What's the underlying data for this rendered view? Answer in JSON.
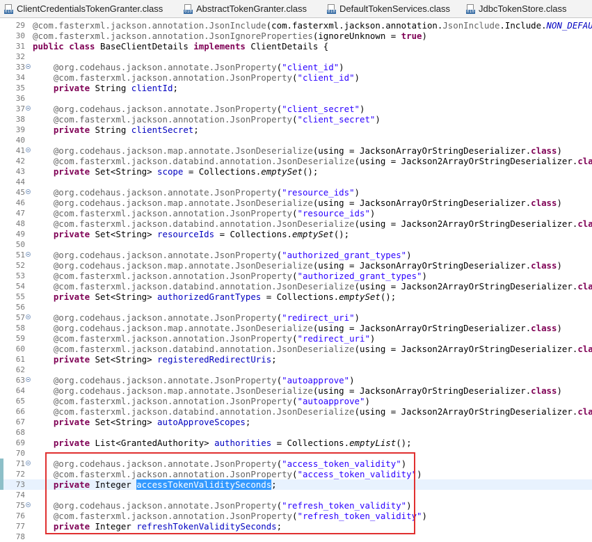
{
  "tabs": [
    {
      "label": "ClientCredentialsTokenGranter.class",
      "icon": "class-file-icon"
    },
    {
      "label": "AbstractTokenGranter.class",
      "icon": "class-file-icon"
    },
    {
      "label": "DefaultTokenServices.class",
      "icon": "class-file-icon"
    },
    {
      "label": "JdbcTokenStore.class",
      "icon": "class-file-icon"
    }
  ],
  "icon_badge": "010",
  "lines": [
    {
      "n": "29",
      "t": [
        [
          "ann",
          "@com.fasterxml.jackson.annotation."
        ],
        [
          "ann",
          "JsonInclude"
        ],
        [
          "",
          "(com.fasterxml.jackson.annotation."
        ],
        [
          "ann",
          "JsonInclude"
        ],
        [
          "",
          ".Include."
        ],
        [
          "fld it",
          "NON_DEFAULT"
        ],
        [
          "",
          ")"
        ]
      ]
    },
    {
      "n": "30",
      "t": [
        [
          "ann",
          "@com.fasterxml.jackson.annotation."
        ],
        [
          "ann",
          "JsonIgnoreProperties"
        ],
        [
          "",
          "(ignoreUnknown = "
        ],
        [
          "kw",
          "true"
        ],
        [
          "",
          ")"
        ]
      ]
    },
    {
      "n": "31",
      "t": [
        [
          "kw",
          "public class"
        ],
        [
          "",
          " BaseClientDetails "
        ],
        [
          "kw",
          "implements"
        ],
        [
          "",
          " ClientDetails {"
        ]
      ]
    },
    {
      "n": "32",
      "t": []
    },
    {
      "n": "33",
      "fold": true,
      "t": [
        [
          "",
          "    "
        ],
        [
          "ann",
          "@org.codehaus.jackson.annotate."
        ],
        [
          "ann",
          "JsonProperty"
        ],
        [
          "",
          "("
        ],
        [
          "str",
          "\"client_id\""
        ],
        [
          "",
          ")"
        ]
      ]
    },
    {
      "n": "34",
      "t": [
        [
          "",
          "    "
        ],
        [
          "ann",
          "@com.fasterxml.jackson.annotation."
        ],
        [
          "ann",
          "JsonProperty"
        ],
        [
          "",
          "("
        ],
        [
          "str",
          "\"client_id\""
        ],
        [
          "",
          ")"
        ]
      ]
    },
    {
      "n": "35",
      "t": [
        [
          "",
          "    "
        ],
        [
          "kw",
          "private"
        ],
        [
          "",
          " String "
        ],
        [
          "fld",
          "clientId"
        ],
        [
          "",
          ";"
        ]
      ]
    },
    {
      "n": "36",
      "t": []
    },
    {
      "n": "37",
      "fold": true,
      "t": [
        [
          "",
          "    "
        ],
        [
          "ann",
          "@org.codehaus.jackson.annotate."
        ],
        [
          "ann",
          "JsonProperty"
        ],
        [
          "",
          "("
        ],
        [
          "str",
          "\"client_secret\""
        ],
        [
          "",
          ")"
        ]
      ]
    },
    {
      "n": "38",
      "t": [
        [
          "",
          "    "
        ],
        [
          "ann",
          "@com.fasterxml.jackson.annotation."
        ],
        [
          "ann",
          "JsonProperty"
        ],
        [
          "",
          "("
        ],
        [
          "str",
          "\"client_secret\""
        ],
        [
          "",
          ")"
        ]
      ]
    },
    {
      "n": "39",
      "t": [
        [
          "",
          "    "
        ],
        [
          "kw",
          "private"
        ],
        [
          "",
          " String "
        ],
        [
          "fld",
          "clientSecret"
        ],
        [
          "",
          ";"
        ]
      ]
    },
    {
      "n": "40",
      "t": []
    },
    {
      "n": "41",
      "fold": true,
      "t": [
        [
          "",
          "    "
        ],
        [
          "ann",
          "@org.codehaus.jackson.map.annotate."
        ],
        [
          "ann",
          "JsonDeserialize"
        ],
        [
          "",
          "(using = JacksonArrayOrStringDeserializer."
        ],
        [
          "kw",
          "class"
        ],
        [
          "",
          ")"
        ]
      ]
    },
    {
      "n": "42",
      "t": [
        [
          "",
          "    "
        ],
        [
          "ann",
          "@com.fasterxml.jackson.databind.annotation."
        ],
        [
          "ann",
          "JsonDeserialize"
        ],
        [
          "",
          "(using = Jackson2ArrayOrStringDeserializer."
        ],
        [
          "kw",
          "class"
        ],
        [
          "",
          ")"
        ]
      ]
    },
    {
      "n": "43",
      "t": [
        [
          "",
          "    "
        ],
        [
          "kw",
          "private"
        ],
        [
          "",
          " Set<String> "
        ],
        [
          "fld",
          "scope"
        ],
        [
          "",
          " = Collections."
        ],
        [
          "it",
          "emptySet"
        ],
        [
          "",
          "();"
        ]
      ]
    },
    {
      "n": "44",
      "t": []
    },
    {
      "n": "45",
      "fold": true,
      "t": [
        [
          "",
          "    "
        ],
        [
          "ann",
          "@org.codehaus.jackson.annotate."
        ],
        [
          "ann",
          "JsonProperty"
        ],
        [
          "",
          "("
        ],
        [
          "str",
          "\"resource_ids\""
        ],
        [
          "",
          ")"
        ]
      ]
    },
    {
      "n": "46",
      "t": [
        [
          "",
          "    "
        ],
        [
          "ann",
          "@org.codehaus.jackson.map.annotate."
        ],
        [
          "ann",
          "JsonDeserialize"
        ],
        [
          "",
          "(using = JacksonArrayOrStringDeserializer."
        ],
        [
          "kw",
          "class"
        ],
        [
          "",
          ")"
        ]
      ]
    },
    {
      "n": "47",
      "t": [
        [
          "",
          "    "
        ],
        [
          "ann",
          "@com.fasterxml.jackson.annotation."
        ],
        [
          "ann",
          "JsonProperty"
        ],
        [
          "",
          "("
        ],
        [
          "str",
          "\"resource_ids\""
        ],
        [
          "",
          ")"
        ]
      ]
    },
    {
      "n": "48",
      "t": [
        [
          "",
          "    "
        ],
        [
          "ann",
          "@com.fasterxml.jackson.databind.annotation."
        ],
        [
          "ann",
          "JsonDeserialize"
        ],
        [
          "",
          "(using = Jackson2ArrayOrStringDeserializer."
        ],
        [
          "kw",
          "class"
        ],
        [
          "",
          ")"
        ]
      ]
    },
    {
      "n": "49",
      "t": [
        [
          "",
          "    "
        ],
        [
          "kw",
          "private"
        ],
        [
          "",
          " Set<String> "
        ],
        [
          "fld",
          "resourceIds"
        ],
        [
          "",
          " = Collections."
        ],
        [
          "it",
          "emptySet"
        ],
        [
          "",
          "();"
        ]
      ]
    },
    {
      "n": "50",
      "t": []
    },
    {
      "n": "51",
      "fold": true,
      "t": [
        [
          "",
          "    "
        ],
        [
          "ann",
          "@org.codehaus.jackson.annotate."
        ],
        [
          "ann",
          "JsonProperty"
        ],
        [
          "",
          "("
        ],
        [
          "str",
          "\"authorized_grant_types\""
        ],
        [
          "",
          ")"
        ]
      ]
    },
    {
      "n": "52",
      "t": [
        [
          "",
          "    "
        ],
        [
          "ann",
          "@org.codehaus.jackson.map.annotate."
        ],
        [
          "ann",
          "JsonDeserialize"
        ],
        [
          "",
          "(using = JacksonArrayOrStringDeserializer."
        ],
        [
          "kw",
          "class"
        ],
        [
          "",
          ")"
        ]
      ]
    },
    {
      "n": "53",
      "t": [
        [
          "",
          "    "
        ],
        [
          "ann",
          "@com.fasterxml.jackson.annotation."
        ],
        [
          "ann",
          "JsonProperty"
        ],
        [
          "",
          "("
        ],
        [
          "str",
          "\"authorized_grant_types\""
        ],
        [
          "",
          ")"
        ]
      ]
    },
    {
      "n": "54",
      "t": [
        [
          "",
          "    "
        ],
        [
          "ann",
          "@com.fasterxml.jackson.databind.annotation."
        ],
        [
          "ann",
          "JsonDeserialize"
        ],
        [
          "",
          "(using = Jackson2ArrayOrStringDeserializer."
        ],
        [
          "kw",
          "class"
        ],
        [
          "",
          ")"
        ]
      ]
    },
    {
      "n": "55",
      "t": [
        [
          "",
          "    "
        ],
        [
          "kw",
          "private"
        ],
        [
          "",
          " Set<String> "
        ],
        [
          "fld",
          "authorizedGrantTypes"
        ],
        [
          "",
          " = Collections."
        ],
        [
          "it",
          "emptySet"
        ],
        [
          "",
          "();"
        ]
      ]
    },
    {
      "n": "56",
      "t": []
    },
    {
      "n": "57",
      "fold": true,
      "t": [
        [
          "",
          "    "
        ],
        [
          "ann",
          "@org.codehaus.jackson.annotate."
        ],
        [
          "ann",
          "JsonProperty"
        ],
        [
          "",
          "("
        ],
        [
          "str",
          "\"redirect_uri\""
        ],
        [
          "",
          ")"
        ]
      ]
    },
    {
      "n": "58",
      "t": [
        [
          "",
          "    "
        ],
        [
          "ann",
          "@org.codehaus.jackson.map.annotate."
        ],
        [
          "ann",
          "JsonDeserialize"
        ],
        [
          "",
          "(using = JacksonArrayOrStringDeserializer."
        ],
        [
          "kw",
          "class"
        ],
        [
          "",
          ")"
        ]
      ]
    },
    {
      "n": "59",
      "t": [
        [
          "",
          "    "
        ],
        [
          "ann",
          "@com.fasterxml.jackson.annotation."
        ],
        [
          "ann",
          "JsonProperty"
        ],
        [
          "",
          "("
        ],
        [
          "str",
          "\"redirect_uri\""
        ],
        [
          "",
          ")"
        ]
      ]
    },
    {
      "n": "60",
      "t": [
        [
          "",
          "    "
        ],
        [
          "ann",
          "@com.fasterxml.jackson.databind.annotation."
        ],
        [
          "ann",
          "JsonDeserialize"
        ],
        [
          "",
          "(using = Jackson2ArrayOrStringDeserializer."
        ],
        [
          "kw",
          "class"
        ],
        [
          "",
          ")"
        ]
      ]
    },
    {
      "n": "61",
      "t": [
        [
          "",
          "    "
        ],
        [
          "kw",
          "private"
        ],
        [
          "",
          " Set<String> "
        ],
        [
          "fld",
          "registeredRedirectUris"
        ],
        [
          "",
          ";"
        ]
      ]
    },
    {
      "n": "62",
      "t": []
    },
    {
      "n": "63",
      "fold": true,
      "t": [
        [
          "",
          "    "
        ],
        [
          "ann",
          "@org.codehaus.jackson.annotate."
        ],
        [
          "ann",
          "JsonProperty"
        ],
        [
          "",
          "("
        ],
        [
          "str",
          "\"autoapprove\""
        ],
        [
          "",
          ")"
        ]
      ]
    },
    {
      "n": "64",
      "t": [
        [
          "",
          "    "
        ],
        [
          "ann",
          "@org.codehaus.jackson.map.annotate."
        ],
        [
          "ann",
          "JsonDeserialize"
        ],
        [
          "",
          "(using = JacksonArrayOrStringDeserializer."
        ],
        [
          "kw",
          "class"
        ],
        [
          "",
          ")"
        ]
      ]
    },
    {
      "n": "65",
      "t": [
        [
          "",
          "    "
        ],
        [
          "ann",
          "@com.fasterxml.jackson.annotation."
        ],
        [
          "ann",
          "JsonProperty"
        ],
        [
          "",
          "("
        ],
        [
          "str",
          "\"autoapprove\""
        ],
        [
          "",
          ")"
        ]
      ]
    },
    {
      "n": "66",
      "t": [
        [
          "",
          "    "
        ],
        [
          "ann",
          "@com.fasterxml.jackson.databind.annotation."
        ],
        [
          "ann",
          "JsonDeserialize"
        ],
        [
          "",
          "(using = Jackson2ArrayOrStringDeserializer."
        ],
        [
          "kw",
          "class"
        ],
        [
          "",
          ")"
        ]
      ]
    },
    {
      "n": "67",
      "t": [
        [
          "",
          "    "
        ],
        [
          "kw",
          "private"
        ],
        [
          "",
          " Set<String> "
        ],
        [
          "fld",
          "autoApproveScopes"
        ],
        [
          "",
          ";"
        ]
      ]
    },
    {
      "n": "68",
      "t": []
    },
    {
      "n": "69",
      "t": [
        [
          "",
          "    "
        ],
        [
          "kw",
          "private"
        ],
        [
          "",
          " List<GrantedAuthority> "
        ],
        [
          "fld",
          "authorities"
        ],
        [
          "",
          " = Collections."
        ],
        [
          "it",
          "emptyList"
        ],
        [
          "",
          "();"
        ]
      ]
    },
    {
      "n": "70",
      "t": []
    },
    {
      "n": "71",
      "fold": true,
      "changed": true,
      "t": [
        [
          "",
          "    "
        ],
        [
          "ann",
          "@org.codehaus.jackson.annotate."
        ],
        [
          "ann",
          "JsonProperty"
        ],
        [
          "",
          "("
        ],
        [
          "str",
          "\"access_token_validity\""
        ],
        [
          "",
          ")"
        ]
      ]
    },
    {
      "n": "72",
      "changed": true,
      "t": [
        [
          "",
          "    "
        ],
        [
          "ann",
          "@com.fasterxml.jackson.annotation."
        ],
        [
          "ann",
          "JsonProperty"
        ],
        [
          "",
          "("
        ],
        [
          "str",
          "\"access_token_validity\""
        ],
        [
          "",
          ")"
        ]
      ]
    },
    {
      "n": "73",
      "current": true,
      "changed": true,
      "t": [
        [
          "",
          "    "
        ],
        [
          "kw",
          "private"
        ],
        [
          "",
          " Integer "
        ],
        [
          "fld sel",
          "accessTokenValiditySeconds"
        ],
        [
          "",
          ";"
        ]
      ]
    },
    {
      "n": "74",
      "t": []
    },
    {
      "n": "75",
      "fold": true,
      "t": [
        [
          "",
          "    "
        ],
        [
          "ann",
          "@org.codehaus.jackson.annotate."
        ],
        [
          "ann",
          "JsonProperty"
        ],
        [
          "",
          "("
        ],
        [
          "str",
          "\"refresh_token_validity\""
        ],
        [
          "",
          ")"
        ]
      ]
    },
    {
      "n": "76",
      "t": [
        [
          "",
          "    "
        ],
        [
          "ann",
          "@com.fasterxml.jackson.annotation."
        ],
        [
          "ann",
          "JsonProperty"
        ],
        [
          "",
          "("
        ],
        [
          "str",
          "\"refresh_token_validity\""
        ],
        [
          "",
          ")"
        ]
      ]
    },
    {
      "n": "77",
      "t": [
        [
          "",
          "    "
        ],
        [
          "kw",
          "private"
        ],
        [
          "",
          " Integer "
        ],
        [
          "fld",
          "refreshTokenValiditySeconds"
        ],
        [
          "",
          ";"
        ]
      ]
    },
    {
      "n": "78",
      "t": []
    }
  ],
  "colors": {
    "keyword": "#7f0055",
    "annotation": "#646464",
    "string": "#2a00ff",
    "field": "#0000c0",
    "selection": "#3399ff",
    "highlight_box": "#e03030",
    "current_line": "#e8f2fe"
  }
}
